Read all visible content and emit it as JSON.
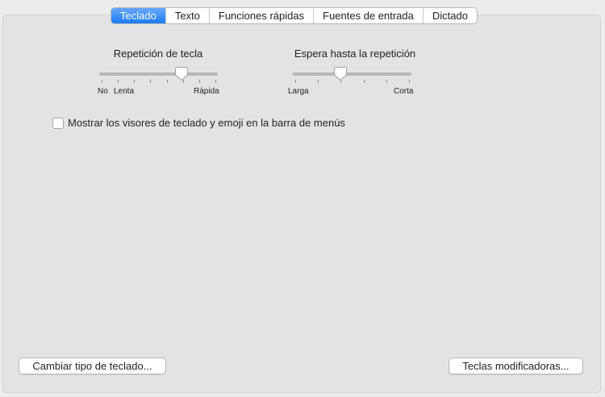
{
  "tabs": [
    {
      "label": "Teclado",
      "active": true
    },
    {
      "label": "Texto",
      "active": false
    },
    {
      "label": "Funciones rápidas",
      "active": false
    },
    {
      "label": "Fuentes de entrada",
      "active": false
    },
    {
      "label": "Dictado",
      "active": false
    }
  ],
  "key_repeat": {
    "title": "Repetición de tecla",
    "min_label": "No",
    "slow_label": "Lenta",
    "max_label": "Rápida",
    "ticks": 8,
    "value_fraction": 0.7
  },
  "delay_until_repeat": {
    "title": "Espera hasta la repetición",
    "min_label": "Larga",
    "max_label": "Corta",
    "ticks": 6,
    "value_fraction": 0.4
  },
  "show_viewers": {
    "label": "Mostrar los visores de teclado y emoji en la barra de menús",
    "checked": false
  },
  "buttons": {
    "change_keyboard_type": "Cambiar tipo de teclado...",
    "modifier_keys": "Teclas modificadoras..."
  },
  "colors": {
    "accent": "#1a7bf5",
    "panel_background": "#e3e3e3",
    "window_background": "#ececec"
  }
}
